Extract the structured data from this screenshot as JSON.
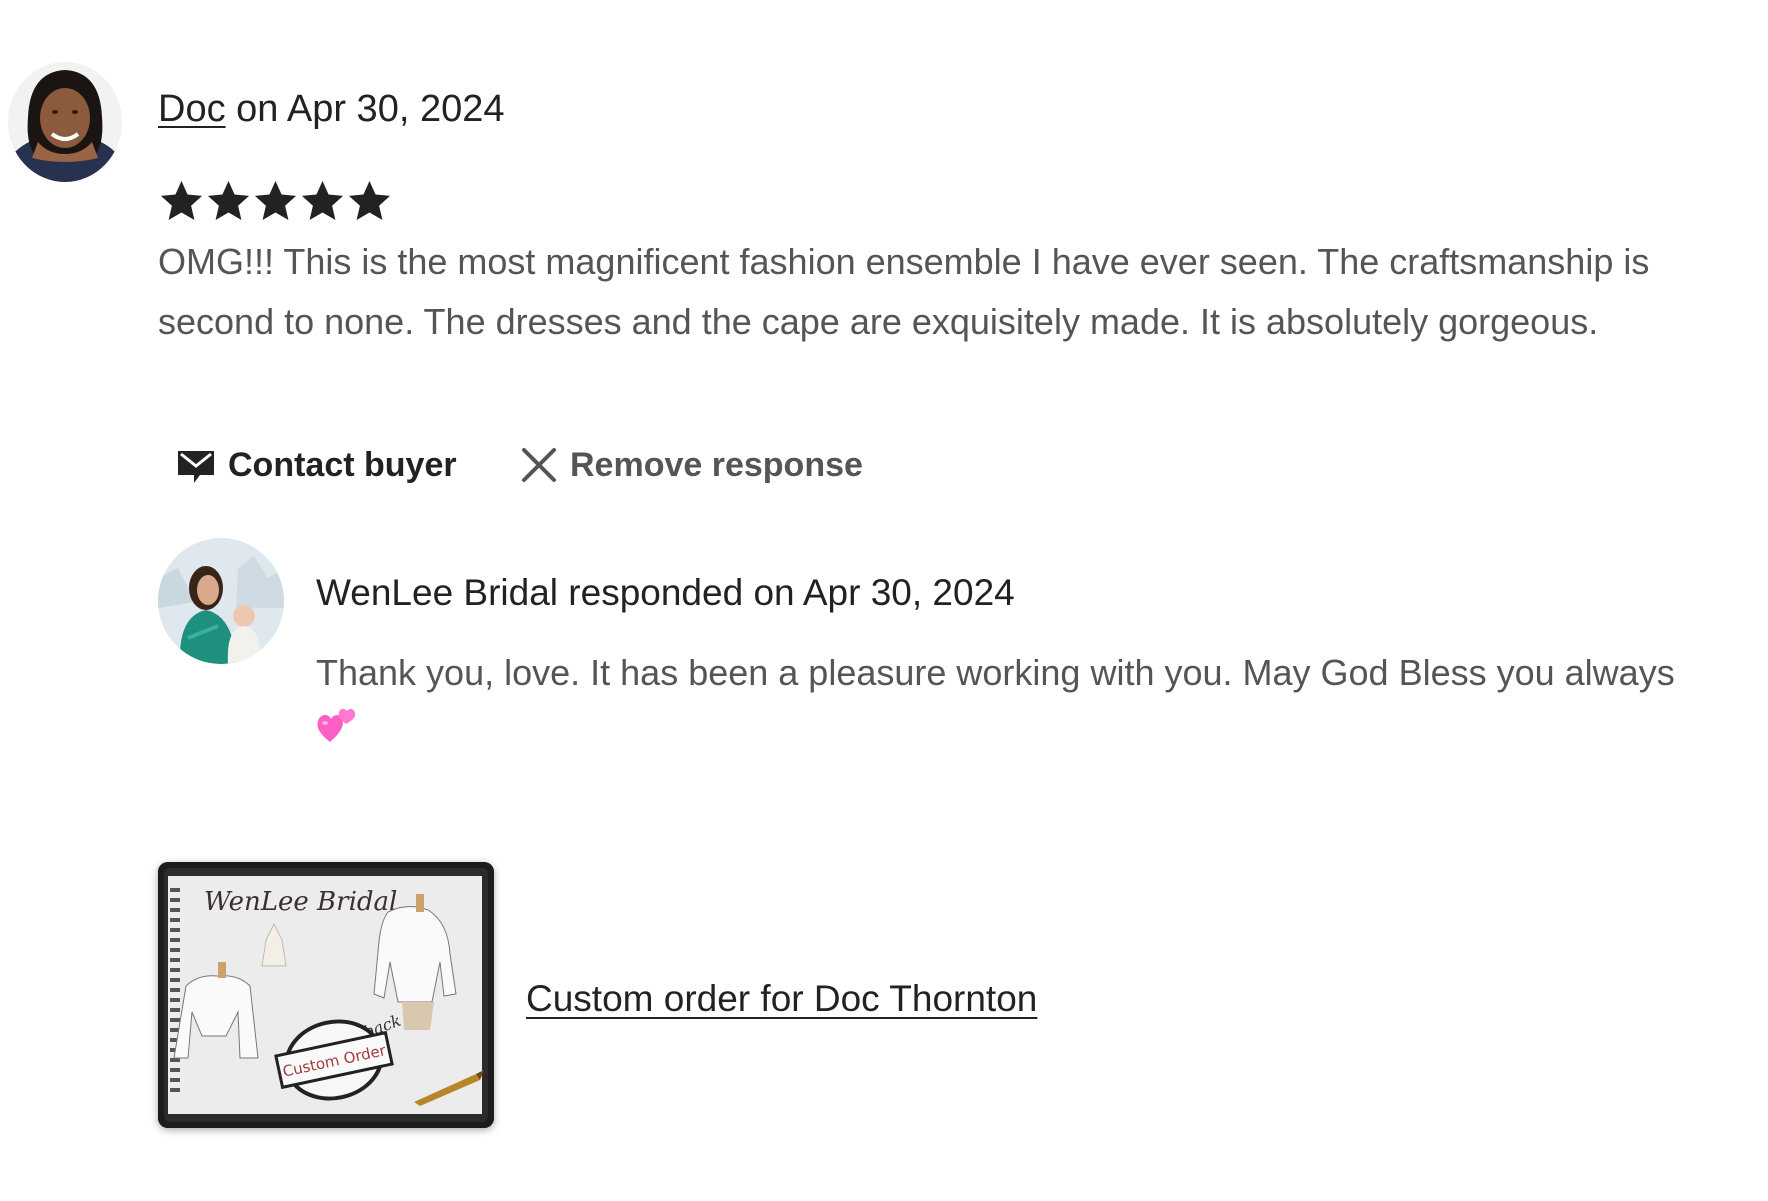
{
  "review": {
    "reviewer_name": "Doc",
    "date_text": " on Apr 30, 2024",
    "rating": 5,
    "rating_max": 5,
    "text": "OMG!!! This is the most magnificent fashion ensemble I have ever seen. The craftsmanship is second to none. The dresses and the cape are exquisitely made. It is absolutely gorgeous."
  },
  "actions": {
    "contact_label": "Contact buyer",
    "remove_label": "Remove response"
  },
  "response": {
    "heading": "WenLee Bridal responded on Apr 30, 2024",
    "text": "Thank you, love. It has been a pleasure working with you. May God Bless you always"
  },
  "order": {
    "link_text": "Custom order for Doc Thornton",
    "thumb_brand": "WenLee Bridal",
    "thumb_stamp": "Custom Order",
    "thumb_back": "back"
  },
  "icons": {
    "star": "star-icon",
    "mail": "mail-icon",
    "close": "close-icon",
    "hearts": "two-hearts-emoji"
  },
  "colors": {
    "text_primary": "#222222",
    "text_secondary": "#555555",
    "star": "#222222",
    "heart": "#ff5fc4"
  }
}
